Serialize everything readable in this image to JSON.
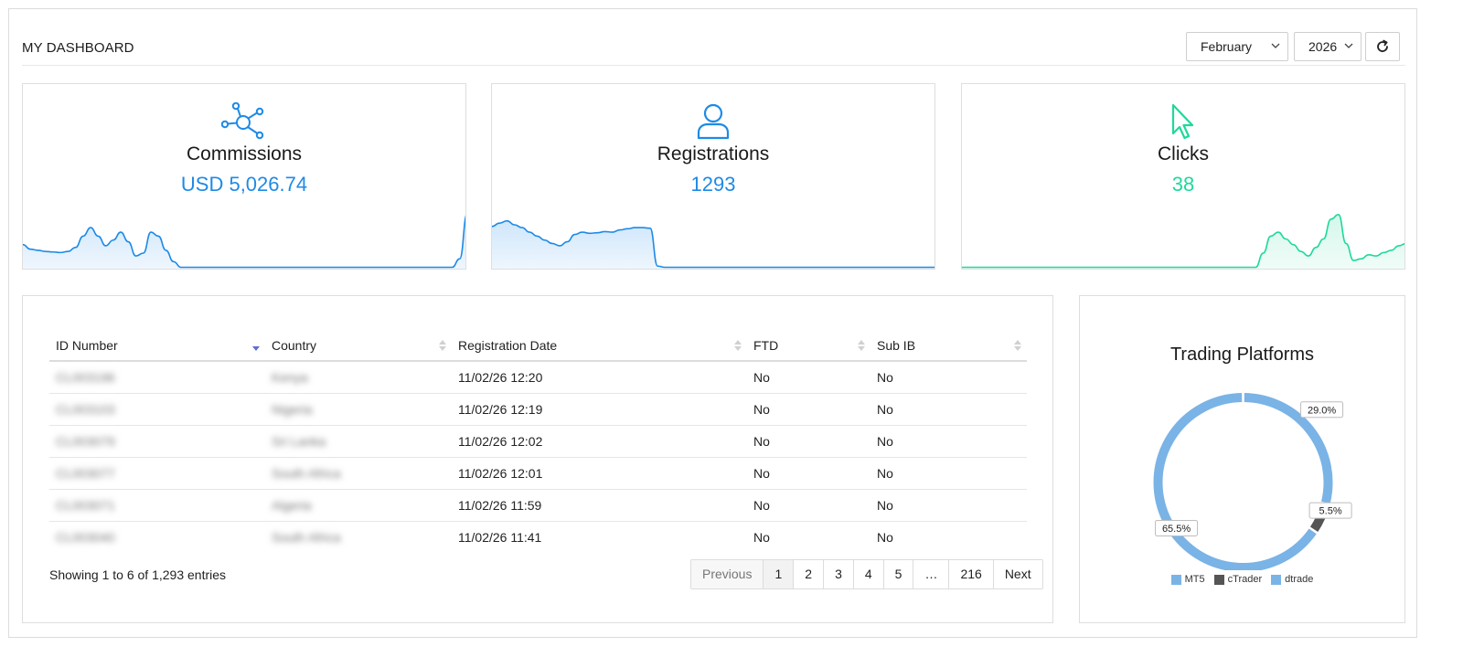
{
  "header": {
    "title": "MY DASHBOARD",
    "month_select": {
      "value": "February"
    },
    "year_select": {
      "value": "2026"
    },
    "refresh_icon": "refresh-icon"
  },
  "cards": [
    {
      "label": "Commissions",
      "value": "USD 5,026.74",
      "icon": "network-icon",
      "color": "#1e8ae6",
      "fill": "#cfe6fb",
      "spark": [
        0.4,
        0.32,
        0.3,
        0.28,
        0.27,
        0.26,
        0.28,
        0.35,
        0.55,
        0.7,
        0.55,
        0.38,
        0.48,
        0.62,
        0.45,
        0.2,
        0.25,
        0.62,
        0.55,
        0.3,
        0.1,
        0.0,
        0.0,
        0.0,
        0.0,
        0.0,
        0.0,
        0.0,
        0.0,
        0.0,
        0.0,
        0.0,
        0.0,
        0.0,
        0.0,
        0.0,
        0.0,
        0.0,
        0.0,
        0.0,
        0.0,
        0.0,
        0.0,
        0.0,
        0.0,
        0.0,
        0.0,
        0.0,
        0.0,
        0.0,
        0.0,
        0.0,
        0.0,
        0.0,
        0.0,
        0.0,
        0.0,
        0.0,
        0.15,
        0.95
      ]
    },
    {
      "label": "Registrations",
      "value": "1293",
      "icon": "user-icon",
      "color": "#1e8ae6",
      "fill": "#cfe6fb",
      "spark": [
        0.72,
        0.78,
        0.82,
        0.75,
        0.7,
        0.62,
        0.55,
        0.48,
        0.42,
        0.38,
        0.45,
        0.58,
        0.62,
        0.6,
        0.61,
        0.63,
        0.62,
        0.66,
        0.68,
        0.7,
        0.7,
        0.69,
        0.02,
        0.0,
        0.0,
        0.0,
        0.0,
        0.0,
        0.0,
        0.0,
        0.0,
        0.0,
        0.0,
        0.0,
        0.0,
        0.0,
        0.0,
        0.0,
        0.0,
        0.0,
        0.0,
        0.0,
        0.0,
        0.0,
        0.0,
        0.0,
        0.0,
        0.0,
        0.0,
        0.0,
        0.0,
        0.0,
        0.0,
        0.0,
        0.0,
        0.0,
        0.0,
        0.0,
        0.0,
        0.0
      ]
    },
    {
      "label": "Clicks",
      "value": "38",
      "icon": "cursor-icon",
      "color": "#1ed99a",
      "fill": "#d4f7ea",
      "spark": [
        0.0,
        0.0,
        0.0,
        0.0,
        0.0,
        0.0,
        0.0,
        0.0,
        0.0,
        0.0,
        0.0,
        0.0,
        0.0,
        0.0,
        0.0,
        0.0,
        0.0,
        0.0,
        0.0,
        0.0,
        0.0,
        0.0,
        0.0,
        0.0,
        0.0,
        0.0,
        0.0,
        0.0,
        0.0,
        0.0,
        0.0,
        0.0,
        0.0,
        0.0,
        0.0,
        0.0,
        0.0,
        0.0,
        0.0,
        0.0,
        0.25,
        0.55,
        0.62,
        0.5,
        0.4,
        0.28,
        0.2,
        0.35,
        0.5,
        0.85,
        0.93,
        0.42,
        0.12,
        0.15,
        0.22,
        0.2,
        0.26,
        0.3,
        0.38,
        0.42
      ]
    }
  ],
  "table": {
    "columns": [
      "ID Number",
      "Country",
      "Registration Date",
      "FTD",
      "Sub IB"
    ],
    "rows": [
      {
        "id": "CL003196",
        "country": "Kenya",
        "date": "11/02/26 12:20",
        "ftd": "No",
        "subib": "No"
      },
      {
        "id": "CL003103",
        "country": "Nigeria",
        "date": "11/02/26 12:19",
        "ftd": "No",
        "subib": "No"
      },
      {
        "id": "CL003079",
        "country": "Sri Lanka",
        "date": "11/02/26 12:02",
        "ftd": "No",
        "subib": "No"
      },
      {
        "id": "CL003077",
        "country": "South Africa",
        "date": "11/02/26 12:01",
        "ftd": "No",
        "subib": "No"
      },
      {
        "id": "CL003071",
        "country": "Algeria",
        "date": "11/02/26 11:59",
        "ftd": "No",
        "subib": "No"
      },
      {
        "id": "CL003040",
        "country": "South Africa",
        "date": "11/02/26 11:41",
        "ftd": "No",
        "subib": "No"
      }
    ],
    "info": "Showing 1 to 6 of 1,293 entries",
    "pagination": [
      "Previous",
      "1",
      "2",
      "3",
      "4",
      "5",
      "…",
      "216",
      "Next"
    ]
  },
  "chart_data": {
    "type": "pie",
    "title": "Trading Platforms",
    "categories": [
      "MT5",
      "cTrader",
      "dtrade"
    ],
    "values": [
      65.5,
      5.5,
      29.0
    ],
    "labels": [
      "65.5%",
      "5.5%",
      "29.0%"
    ],
    "colors": [
      "#7ab3e6",
      "#555555",
      "#7ab3e6"
    ],
    "legend": "bottom"
  }
}
